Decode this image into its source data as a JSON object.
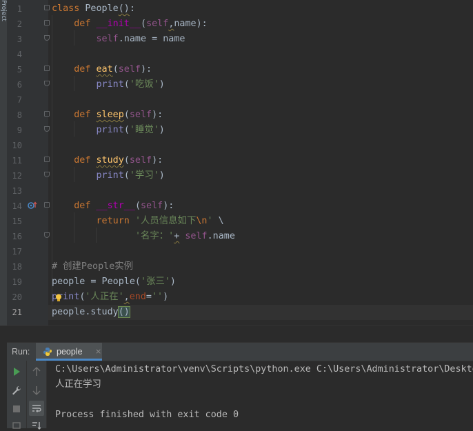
{
  "sidebar": {
    "project_tab": "Project"
  },
  "editor": {
    "line_numbers": [
      "1",
      "2",
      "3",
      "4",
      "5",
      "6",
      "7",
      "8",
      "9",
      "10",
      "11",
      "12",
      "13",
      "14",
      "15",
      "16",
      "17",
      "18",
      "19",
      "20",
      "21"
    ],
    "current_line": 21
  },
  "run_panel": {
    "label": "Run:",
    "tab_name": "people",
    "tab_close": "×",
    "console_lines": [
      "C:\\Users\\Administrator\\venv\\Scripts\\python.exe C:\\Users\\Administrator\\Desktop",
      "人正在学习",
      "",
      "Process finished with exit code 0"
    ]
  },
  "colors": {
    "background": "#2b2b2b",
    "keyword": "#cc7832",
    "self": "#94558d",
    "function": "#ffc66d",
    "dunder": "#b200b2",
    "string": "#6a8759",
    "comment": "#808080",
    "accent": "#4a88c7"
  },
  "icons": {
    "run": "play-icon",
    "wrench": "wrench-icon",
    "stop": "stop-icon",
    "up": "arrow-up-icon",
    "down": "arrow-down-icon",
    "wrap": "soft-wrap-icon",
    "sort": "sort-icon",
    "python": "python-icon",
    "bulb": "intention-bulb-icon",
    "override": "override-method-icon"
  }
}
